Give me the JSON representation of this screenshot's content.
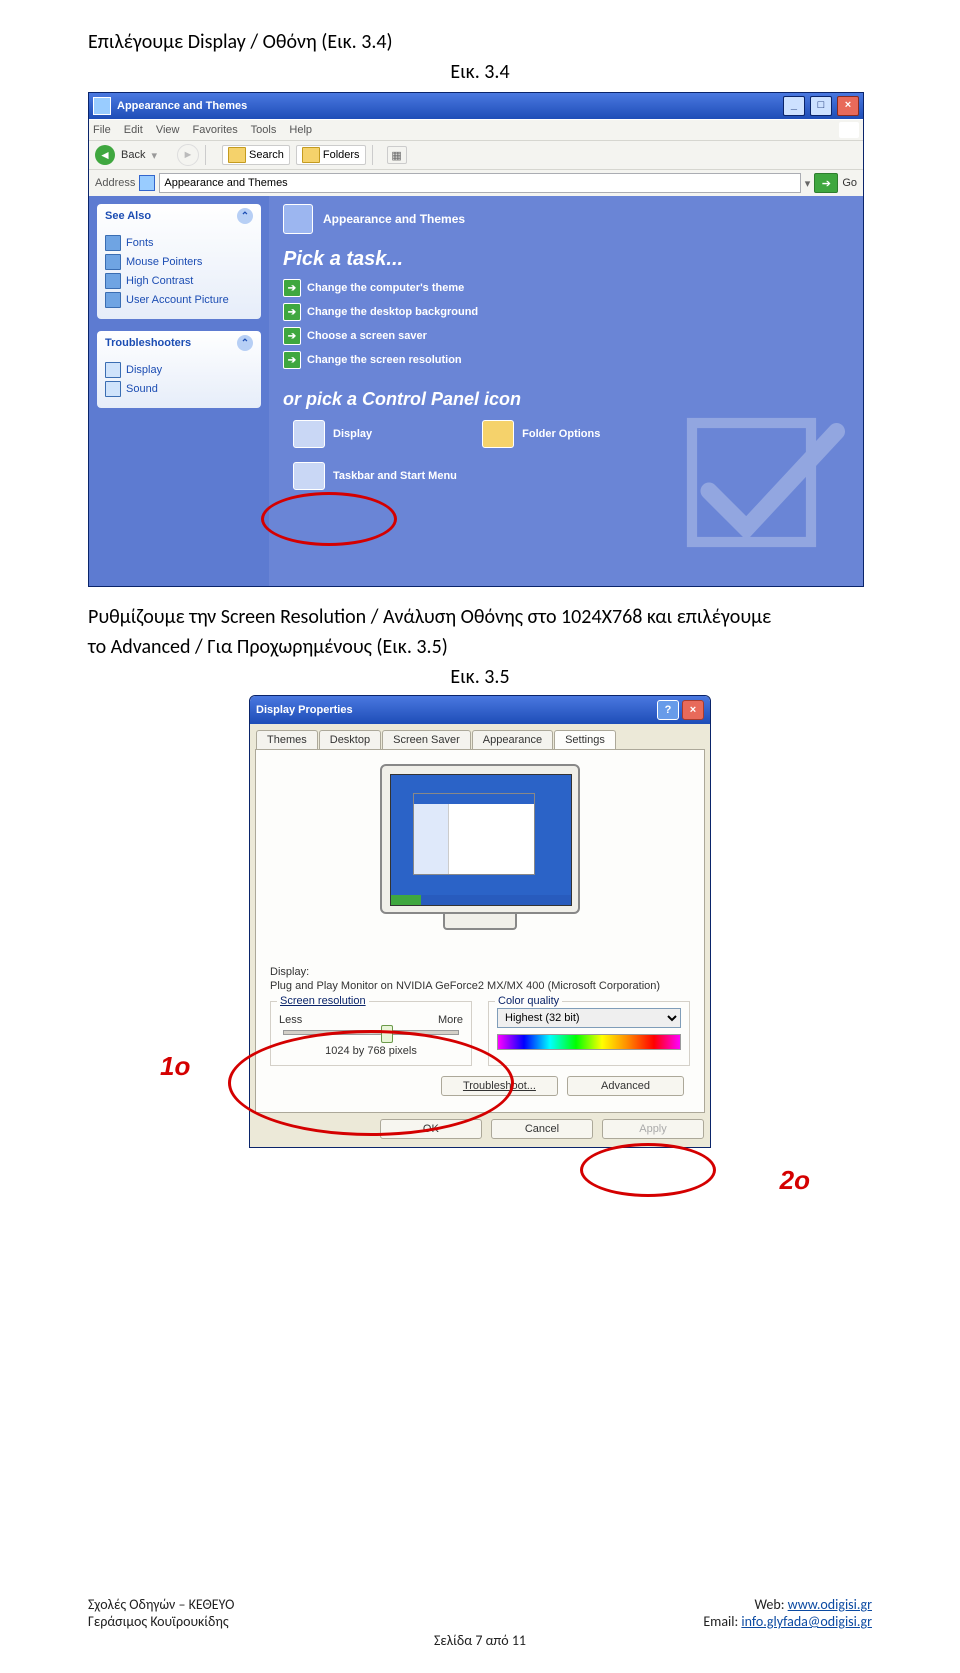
{
  "intro1": "Επιλέγουμε Display / Οθόνη (Εικ. 3.4)",
  "caption1": "Εικ. 3.4",
  "xp1": {
    "title": "Appearance and Themes",
    "menu": [
      "File",
      "Edit",
      "View",
      "Favorites",
      "Tools",
      "Help"
    ],
    "back": "Back",
    "search": "Search",
    "folders": "Folders",
    "addr_label": "Address",
    "addr_value": "Appearance and Themes",
    "go": "Go",
    "see_also_title": "See Also",
    "see_also": [
      "Fonts",
      "Mouse Pointers",
      "High Contrast",
      "User Account Picture"
    ],
    "troubleshoot_title": "Troubleshooters",
    "troubleshoot": [
      "Display",
      "Sound"
    ],
    "content_title": "Appearance and Themes",
    "pick": "Pick a task...",
    "tasks": [
      "Change the computer's theme",
      "Change the desktop background",
      "Choose a screen saver",
      "Change the screen resolution"
    ],
    "orpick": "or pick a Control Panel icon",
    "icon_display": "Display",
    "icon_folder": "Folder Options",
    "icon_taskbar": "Taskbar and Start Menu"
  },
  "intro2a": "Ρυθμίζουμε την Screen Resolution / Ανάλυση Οθόνης στο 1024Χ768 και επιλέγουμε",
  "intro2b": "το Advanced / Για Προχωρημένους (Εικ. 3.5)",
  "caption2": "Εικ. 3.5",
  "dlg": {
    "title": "Display Properties",
    "tabs": [
      "Themes",
      "Desktop",
      "Screen Saver",
      "Appearance",
      "Settings"
    ],
    "display_label": "Display:",
    "display_value": "Plug and Play Monitor on NVIDIA GeForce2 MX/MX 400 (Microsoft Corporation)",
    "sr_label": "Screen resolution",
    "less": "Less",
    "more": "More",
    "sr_value": "1024 by 768 pixels",
    "cq_label": "Color quality",
    "cq_value": "Highest (32 bit)",
    "troubleshoot": "Troubleshoot...",
    "advanced": "Advanced",
    "ok": "OK",
    "cancel": "Cancel",
    "apply": "Apply"
  },
  "annot1": "1o",
  "annot2": "2o",
  "footer": {
    "l1": "Σχολές Οδηγών – ΚΕΘΕΥΟ",
    "l2": "Γεράσιμος Κουϊρουκίδης",
    "web_label": "Web: ",
    "web_url": "www.odigisi.gr",
    "email_label": "Email: ",
    "email_addr": "info.glyfada@odigisi.gr",
    "page": "Σελίδα 7 από 11"
  }
}
